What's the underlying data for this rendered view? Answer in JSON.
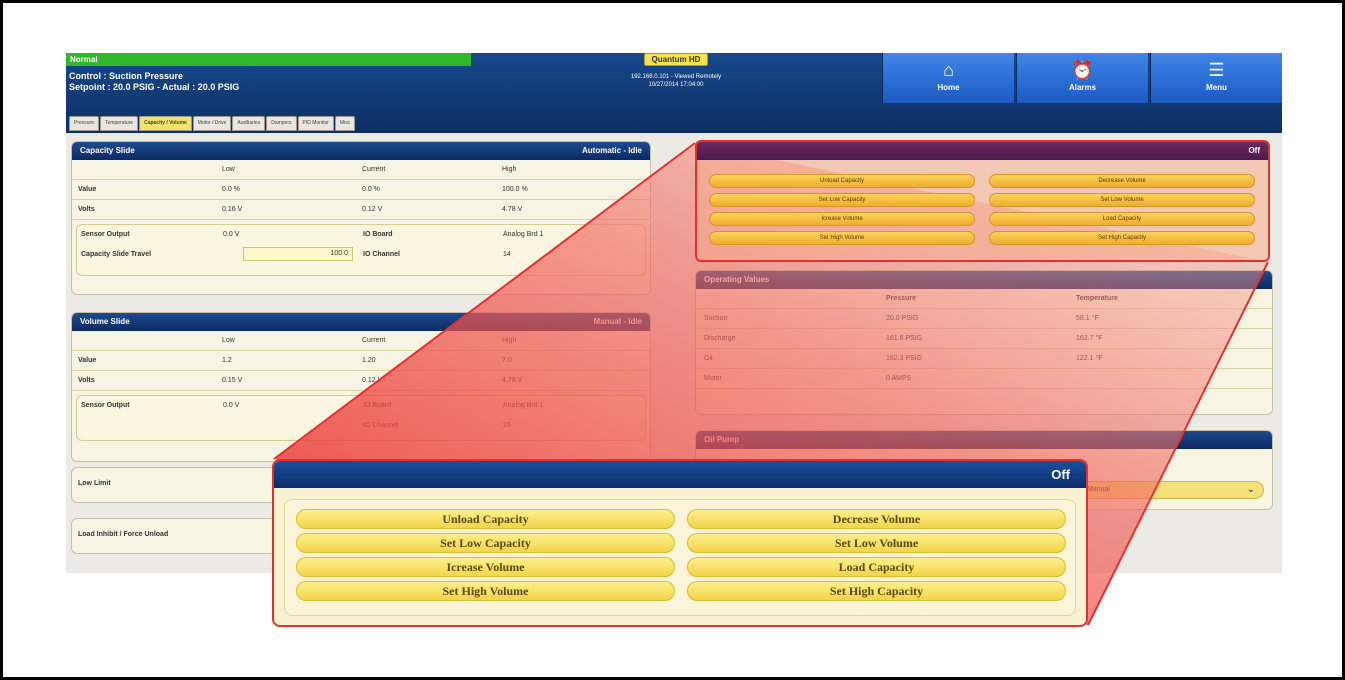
{
  "header": {
    "status": "Normal",
    "control": "Control : Suction Pressure",
    "setpoint": "Setpoint : 20.0 PSIG - Actual : 20.0 PSIG",
    "product": "Quantum HD",
    "remote_line1": "192.168.0.101 - Viewed Remotely",
    "remote_line2": "10/27/2014 17:04:00",
    "nav": [
      {
        "label": "Home",
        "icon": "home-icon"
      },
      {
        "label": "Alarms",
        "icon": "alarm-clock-icon"
      },
      {
        "label": "Menu",
        "icon": "menu-icon"
      }
    ]
  },
  "tabs": [
    "Pressure",
    "Temperature",
    "Capacity / Volume",
    "Motor / Drive",
    "Auxiliaries",
    "Dampers",
    "PID Monitor",
    "Misc"
  ],
  "active_tab": "Capacity / Volume",
  "capacity_slide": {
    "title": "Capacity Slide",
    "mode": "Automatic - Idle",
    "col_low": "Low",
    "col_current": "Current",
    "col_high": "High",
    "value_label": "Value",
    "value_low": "0.0 %",
    "value_current": "0.0 %",
    "value_high": "100.0 %",
    "volts_label": "Volts",
    "volts_low": "0.16 V",
    "volts_current": "0.12 V",
    "volts_high": "4.78 V",
    "sensor_output_label": "Sensor Output",
    "sensor_output": "0.0 V",
    "io_board_label": "IO Board",
    "io_board": "Analog Brd 1",
    "travel_label": "Capacity Slide Travel",
    "travel": "100.0",
    "io_channel_label": "IO Channel",
    "io_channel": "14"
  },
  "volume_slide": {
    "title": "Volume Slide",
    "mode": "Manual - Idle",
    "col_low": "Low",
    "col_current": "Current",
    "col_high": "High",
    "value_label": "Value",
    "value_low": "1.2",
    "value_current": "1.20",
    "value_high": "7.0",
    "volts_label": "Volts",
    "volts_low": "0.15 V",
    "volts_current": "0.12 V",
    "volts_high": "4.78 V",
    "sensor_output_label": "Sensor Output",
    "sensor_output": "0.0 V",
    "io_board_label": "IO Board",
    "io_board": "Analog Brd 1",
    "io_channel_label": "IO Channel",
    "io_channel": "15",
    "low_limit_label": "Low Limit",
    "load_inhibit_label": "Load Inhibit / Force Unload"
  },
  "capacity_control": {
    "state": "Off",
    "buttons": [
      "Unload Capacity",
      "Decrease Volume",
      "Set Low Capacity",
      "Set Low Volume",
      "Icrease Volume",
      "Load Capacity",
      "Set High Volume",
      "Set High Capacity"
    ]
  },
  "operating_values": {
    "title": "Operating Values",
    "col_pressure": "Pressure",
    "col_temperature": "Temperature",
    "rows": [
      {
        "label": "Suction",
        "pressure": "20.0 PSIG",
        "temperature": "58.1 °F"
      },
      {
        "label": "Discharge",
        "pressure": "161.8 PSIG",
        "temperature": "162.7 °F"
      },
      {
        "label": "Oil",
        "pressure": "162.3 PSIG",
        "temperature": "122.1 °F"
      },
      {
        "label": "Motor",
        "pressure": "0 AMPS",
        "temperature": ""
      }
    ]
  },
  "oil_pump": {
    "title": "Oil Pump",
    "select_value": "Manual"
  },
  "colors": {
    "header_blue": "#0d2f63",
    "status_green": "#2fb82c",
    "highlight_red": "#e53030",
    "button_yellow": "#f3d54a"
  }
}
